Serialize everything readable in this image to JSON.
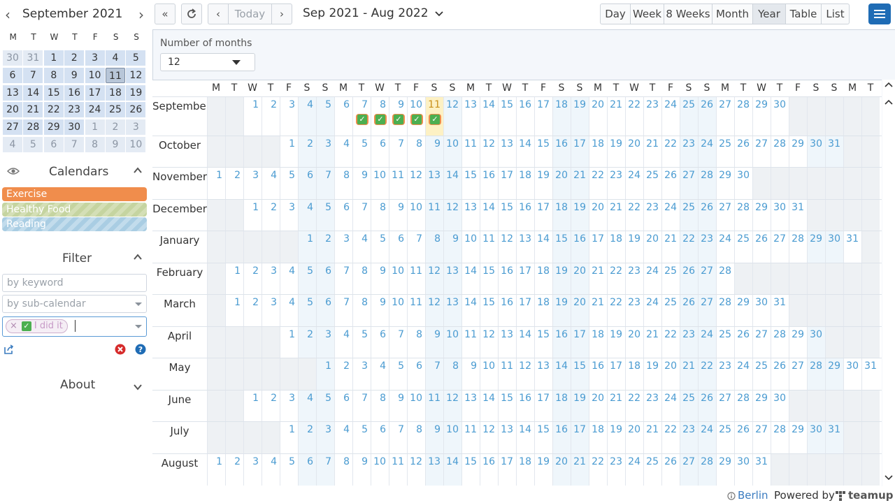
{
  "mini_calendar": {
    "month": "September",
    "year": "2021",
    "weekday_headers": [
      "M",
      "T",
      "W",
      "T",
      "F",
      "S",
      "S"
    ],
    "weeks": [
      [
        "30",
        "31",
        "1",
        "2",
        "3",
        "4",
        "5"
      ],
      [
        "6",
        "7",
        "8",
        "9",
        "10",
        "11",
        "12"
      ],
      [
        "13",
        "14",
        "15",
        "16",
        "17",
        "18",
        "19"
      ],
      [
        "20",
        "21",
        "22",
        "23",
        "24",
        "25",
        "26"
      ],
      [
        "27",
        "28",
        "29",
        "30",
        "1",
        "2",
        "3"
      ],
      [
        "4",
        "5",
        "6",
        "7",
        "8",
        "9",
        "10"
      ]
    ],
    "today": "11"
  },
  "calendars": {
    "title": "Calendars",
    "items": [
      {
        "label": "Exercise",
        "color": "#f08d4c"
      },
      {
        "label": "Healthy Food",
        "color": "#c5d4a0"
      },
      {
        "label": "Reading",
        "color": "#a9cde3"
      }
    ]
  },
  "filter": {
    "title": "Filter",
    "keyword_placeholder": "by keyword",
    "subcalendar_placeholder": "by sub-calendar",
    "tag_label": "I did it",
    "tag_remove": "×"
  },
  "about": {
    "title": "About"
  },
  "toolbar": {
    "today_label": "Today",
    "range_label": "Sep 2021 - Aug 2022",
    "views": [
      "Day",
      "Week",
      "8 Weeks",
      "Month",
      "Year",
      "Table",
      "List"
    ],
    "active_view": "Year"
  },
  "number_of_months": {
    "label": "Number of months",
    "value": "12"
  },
  "year_view": {
    "weekday_headers": [
      "M",
      "T",
      "W",
      "T",
      "F",
      "S",
      "S",
      "M",
      "T",
      "W",
      "T",
      "F",
      "S",
      "S",
      "M",
      "T",
      "W",
      "T",
      "F",
      "S",
      "S",
      "M",
      "T",
      "W",
      "T",
      "F",
      "S",
      "S",
      "M",
      "T",
      "W",
      "T",
      "F",
      "S",
      "S",
      "M",
      "T"
    ],
    "months": [
      {
        "name": "September",
        "offset": 2,
        "days": 30
      },
      {
        "name": "October",
        "offset": 4,
        "days": 31
      },
      {
        "name": "November",
        "offset": 0,
        "days": 30
      },
      {
        "name": "December",
        "offset": 2,
        "days": 31
      },
      {
        "name": "January",
        "offset": 5,
        "days": 31
      },
      {
        "name": "February",
        "offset": 1,
        "days": 28
      },
      {
        "name": "March",
        "offset": 1,
        "days": 31
      },
      {
        "name": "April",
        "offset": 4,
        "days": 30
      },
      {
        "name": "May",
        "offset": 6,
        "days": 31
      },
      {
        "name": "June",
        "offset": 2,
        "days": 30
      },
      {
        "name": "July",
        "offset": 4,
        "days": 31
      },
      {
        "name": "August",
        "offset": 0,
        "days": 31
      }
    ],
    "today": {
      "month": 0,
      "day": 11
    },
    "events": [
      {
        "month": 0,
        "day": 7,
        "calendar": "Exercise"
      },
      {
        "month": 0,
        "day": 8,
        "calendar": "Exercise"
      },
      {
        "month": 0,
        "day": 9,
        "calendar": "Exercise"
      },
      {
        "month": 0,
        "day": 10,
        "calendar": "Exercise"
      },
      {
        "month": 0,
        "day": 11,
        "calendar": "Exercise"
      }
    ]
  },
  "footer": {
    "timezone": "Berlin",
    "powered_by": "Powered by",
    "brand": "teamup"
  },
  "colors": {
    "accent": "#1f6cb5",
    "exercise": "#f08d4c",
    "link": "#4a9bd1",
    "today": "#fdf1c4"
  }
}
